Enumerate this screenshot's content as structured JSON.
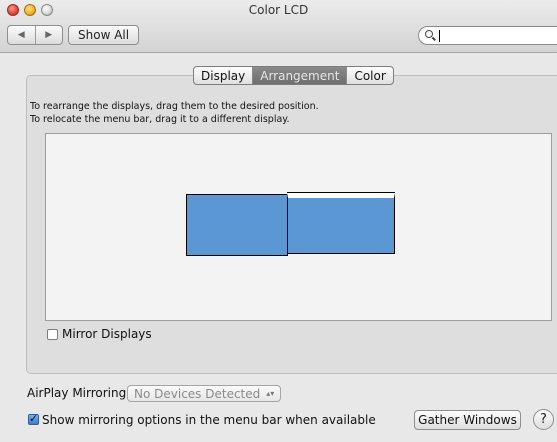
{
  "window": {
    "title": "Color LCD"
  },
  "toolbar": {
    "back_icon": "◀",
    "forward_icon": "▶",
    "show_all_label": "Show All",
    "search_value": ""
  },
  "tabs": [
    {
      "label": "Display",
      "active": false
    },
    {
      "label": "Arrangement",
      "active": true
    },
    {
      "label": "Color",
      "active": false
    }
  ],
  "arrangement": {
    "instruction_1": "To rearrange the displays, drag them to the desired position.",
    "instruction_2": "To relocate the menu bar, drag it to a different display.",
    "display_color": "#5a97d3",
    "mirror_displays": {
      "label": "Mirror Displays",
      "checked": false
    }
  },
  "airplay": {
    "label": "AirPlay Mirroring:",
    "selected": "No Devices Detected"
  },
  "mirroring_options": {
    "label": "Show mirroring options in the menu bar when available",
    "checked": true
  },
  "buttons": {
    "gather_windows": "Gather Windows",
    "help": "?"
  }
}
